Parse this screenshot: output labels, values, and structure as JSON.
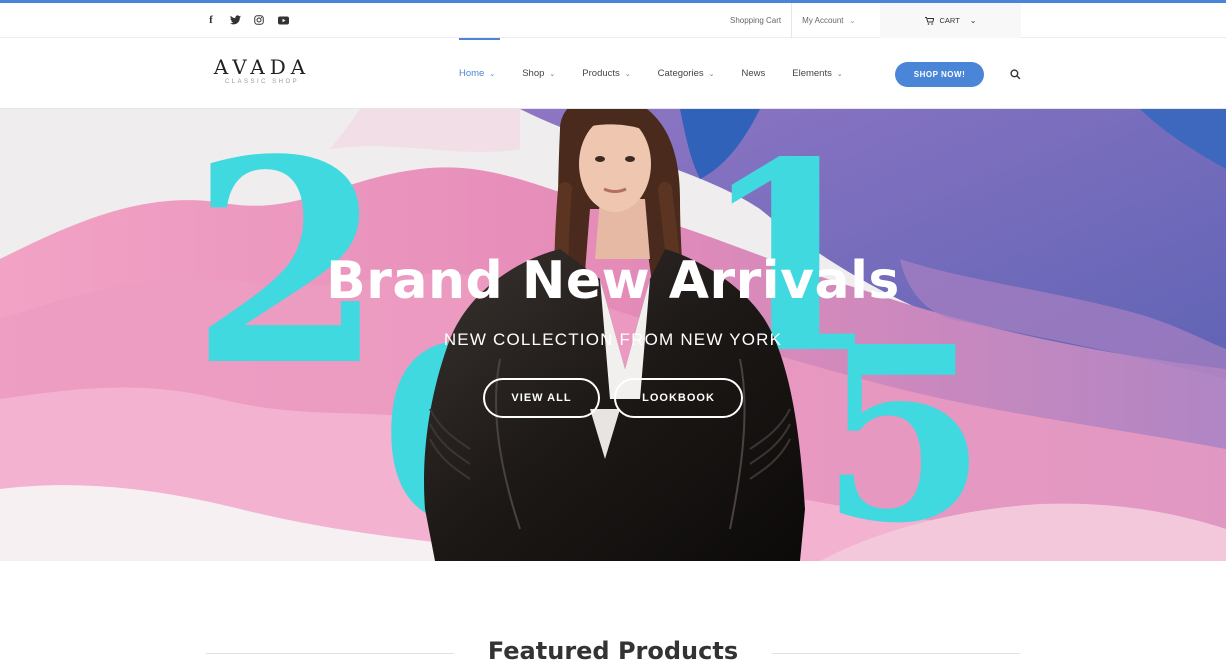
{
  "topbar": {
    "social": [
      {
        "icon": "facebook-icon",
        "glyph": "f"
      },
      {
        "icon": "twitter-icon",
        "glyph": "❦"
      },
      {
        "icon": "instagram-icon",
        "glyph": "◎"
      },
      {
        "icon": "youtube-icon",
        "glyph": "▶"
      }
    ],
    "shopping_cart": "Shopping Cart",
    "my_account": "My Account",
    "cart": "CART"
  },
  "header": {
    "logo_main": "AVADA",
    "logo_sub": "CLASSIC SHOP",
    "nav": [
      {
        "label": "Home",
        "dropdown": true,
        "active": true
      },
      {
        "label": "Shop",
        "dropdown": true
      },
      {
        "label": "Products",
        "dropdown": true
      },
      {
        "label": "Categories",
        "dropdown": true
      },
      {
        "label": "News",
        "dropdown": false
      },
      {
        "label": "Elements",
        "dropdown": true
      }
    ],
    "shop_button": "SHOP NOW!"
  },
  "hero": {
    "title": "Brand New Arrivals",
    "subtitle": "NEW COLLECTION FROM NEW YORK",
    "view_all": "VIEW ALL",
    "lookbook": "LOOKBOOK",
    "decor_numerals": [
      "2",
      "0",
      "1",
      "5"
    ]
  },
  "featured": {
    "title": "Featured Products"
  },
  "colors": {
    "accent": "#4a86d8",
    "cyan": "#3fd9df",
    "pink": "#e889b6",
    "purple": "#8a78c6"
  }
}
